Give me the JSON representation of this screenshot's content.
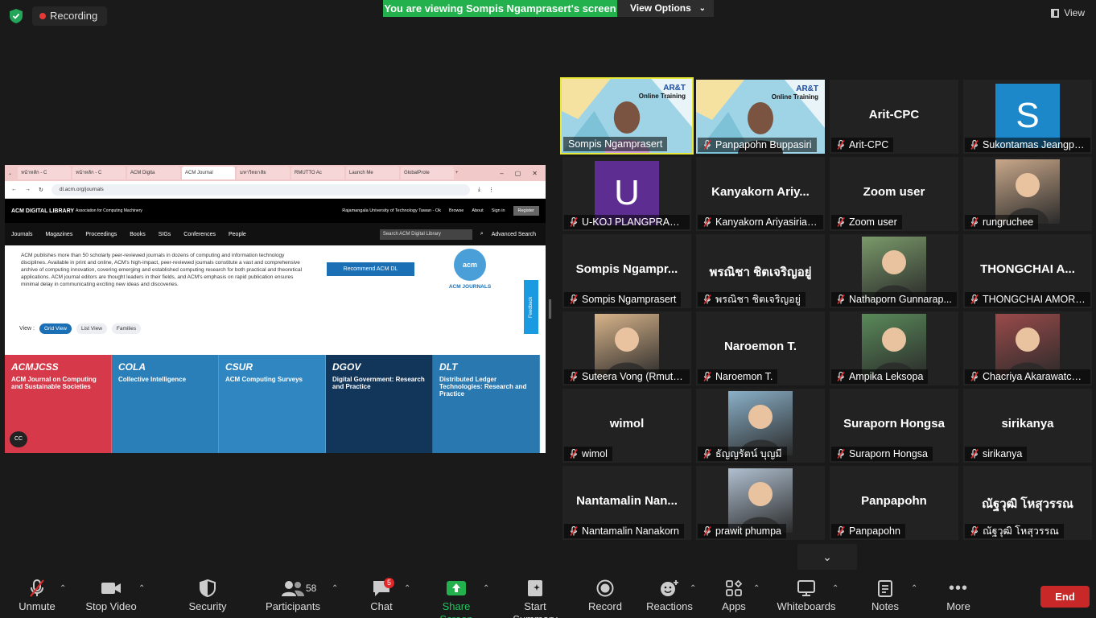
{
  "top": {
    "recording_label": "Recording",
    "banner": "You are viewing Sompis Ngamprasert's screen",
    "view_options": "View Options",
    "view_label": "View"
  },
  "shared_screen": {
    "tabs": [
      "หน้าหลัก - C",
      "หน้าหลัก - C",
      "ACM Digita",
      "ACM Journal",
      "มหาวิทยาลัย",
      "RMUTTO Ac",
      "Launch Me",
      "GlobalProte"
    ],
    "url": "dl.acm.org/journals",
    "acm_logo": "ACM DIGITAL LIBRARY",
    "assoc": "Association for Computing Machinery",
    "institution": "Rajamangala University of Technology Tawan - Ok",
    "header_links": [
      "Browse",
      "About",
      "Sign in"
    ],
    "register": "Register",
    "nav": [
      "Journals",
      "Magazines",
      "Proceedings",
      "Books",
      "SIGs",
      "Conferences",
      "People"
    ],
    "search_placeholder": "Search ACM Digital Library",
    "advanced_search": "Advanced Search",
    "intro": "ACM publishes more than 50 scholarly peer-reviewed journals in dozens of computing and information technology disciplines. Available in print and online, ACM's high-impact, peer-reviewed journals constitute a vast and comprehensive archive of computing innovation, covering emerging and established computing research for both practical and theoretical applications. ACM journal editors are thought leaders in their fields, and ACM's emphasis on rapid publication ensures minimal delay in communicating exciting new ideas and discoveries.",
    "recommend": "Recommend ACM DL",
    "acm_journals": "ACM JOURNALS",
    "acm_circle": "acm",
    "feedback": "Feedback",
    "view_label": "View :",
    "view_buttons": [
      "Grid View",
      "List View",
      "Families"
    ],
    "cards": [
      {
        "abbr": "ACMJCSS",
        "title": "ACM Journal on Computing and Sustainable Societies",
        "color": "#d63a4a"
      },
      {
        "abbr": "COLA",
        "title": "Collective Intelligence",
        "color": "#2a7fb8"
      },
      {
        "abbr": "CSUR",
        "title": "ACM Computing Surveys",
        "color": "#2f86c0"
      },
      {
        "abbr": "DGOV",
        "title": "Digital Government: Research and Practice",
        "color": "#12365a"
      },
      {
        "abbr": "DLT",
        "title": "Distributed Ledger Technologies: Research and Practice",
        "color": "#2a78b0"
      }
    ]
  },
  "gallery": [
    {
      "big": "",
      "label": "Sompis Ngamprasert",
      "muted": false,
      "type": "video"
    },
    {
      "big": "",
      "label": "Panpapohn Buppasiri",
      "muted": true,
      "type": "video"
    },
    {
      "big": "Arit-CPC",
      "label": "Arit-CPC",
      "muted": true,
      "type": "name"
    },
    {
      "big": "S",
      "label": "Sukontamas Jeangpu...",
      "muted": true,
      "type": "avatar",
      "color": "#1c87c9"
    },
    {
      "big": "U",
      "label": "U-KOJ PLANGPRASO...",
      "muted": true,
      "type": "avatar",
      "color": "#5e2d91"
    },
    {
      "big": "Kanyakorn Ariy...",
      "label": "Kanyakorn Ariyasiriap...",
      "muted": true,
      "type": "name"
    },
    {
      "big": "Zoom user",
      "label": "Zoom user",
      "muted": true,
      "type": "name"
    },
    {
      "big": "",
      "label": "rungruchee",
      "muted": true,
      "type": "photo",
      "color": "#c9a88a"
    },
    {
      "big": "Sompis Ngampr...",
      "label": "Sompis Ngamprasert",
      "muted": true,
      "type": "name"
    },
    {
      "big": "พรณิชา ชิตเจริญอยู่",
      "label": "พรณิชา ชิตเจริญอยู่",
      "muted": true,
      "type": "name"
    },
    {
      "big": "",
      "label": "Nathaporn Gunnarap...",
      "muted": true,
      "type": "photo",
      "color": "#7a9a6a"
    },
    {
      "big": "THONGCHAI A...",
      "label": "THONGCHAI AMORN...",
      "muted": true,
      "type": "name"
    },
    {
      "big": "",
      "label": "Suteera Vong (RmuttO)",
      "muted": true,
      "type": "photo",
      "color": "#d8b48a"
    },
    {
      "big": "Naroemon T.",
      "label": "Naroemon T.",
      "muted": true,
      "type": "name"
    },
    {
      "big": "",
      "label": "Ampika Leksopa",
      "muted": true,
      "type": "photo",
      "color": "#5a8a5a"
    },
    {
      "big": "",
      "label": "Chacriya Akarawatcha...",
      "muted": true,
      "type": "photo",
      "color": "#9a4a4a"
    },
    {
      "big": "wimol",
      "label": "wimol",
      "muted": true,
      "type": "name"
    },
    {
      "big": "",
      "label": "ธัญญรัตน์ บุญมี",
      "muted": true,
      "type": "photo",
      "color": "#8ab0c8"
    },
    {
      "big": "Suraporn Hongsa",
      "label": "Suraporn Hongsa",
      "muted": true,
      "type": "name"
    },
    {
      "big": "sirikanya",
      "label": "sirikanya",
      "muted": true,
      "type": "name"
    },
    {
      "big": "Nantamalin Nan...",
      "label": "Nantamalin Nanakorn",
      "muted": true,
      "type": "name"
    },
    {
      "big": "",
      "label": "prawit phumpa",
      "muted": true,
      "type": "photo",
      "color": "#b0c0d0"
    },
    {
      "big": "Panpapohn",
      "label": "Panpapohn",
      "muted": true,
      "type": "name"
    },
    {
      "big": "ณัฐวุฒิ โหสุวรรณ",
      "label": "ณัฐวุฒิ โหสุวรรณ",
      "muted": true,
      "type": "name"
    }
  ],
  "video_overlay": {
    "logo": "AR&T",
    "text": "Online Training"
  },
  "toolbar": {
    "unmute": "Unmute",
    "stop_video": "Stop Video",
    "security": "Security",
    "participants": "Participants",
    "participants_count": "58",
    "chat": "Chat",
    "chat_badge": "5",
    "share_screen": "Share Screen",
    "start_summary": "Start Summary",
    "record": "Record",
    "reactions": "Reactions",
    "apps": "Apps",
    "whiteboards": "Whiteboards",
    "notes": "Notes",
    "more": "More",
    "end": "End"
  },
  "colors": {
    "share_green": "#22b14c",
    "end_red": "#c92828",
    "active_speaker": "#e8e836"
  }
}
